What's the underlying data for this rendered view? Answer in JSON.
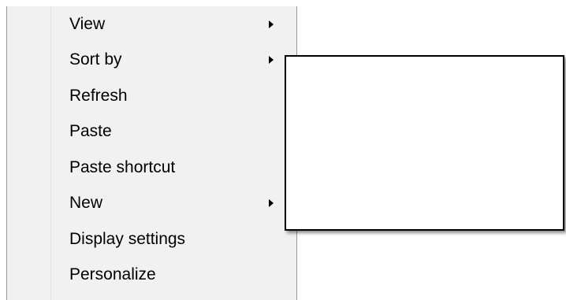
{
  "context_menu": {
    "items": [
      {
        "label": "View",
        "has_submenu": true
      },
      {
        "label": "Sort by",
        "has_submenu": true
      },
      {
        "label": "Refresh",
        "has_submenu": false
      },
      {
        "label": "Paste",
        "has_submenu": false
      },
      {
        "label": "Paste shortcut",
        "has_submenu": false
      },
      {
        "label": "New",
        "has_submenu": true
      },
      {
        "label": "Display settings",
        "has_submenu": false
      },
      {
        "label": "Personalize",
        "has_submenu": false
      }
    ],
    "submenu_arrow_icon": "chevron-right-icon"
  },
  "submenu": {
    "open_for": "Sort by",
    "items": []
  },
  "colors": {
    "menu_background": "#f1f1f1",
    "menu_border": "#979797",
    "text": "#000000",
    "submenu_border": "#000000"
  }
}
